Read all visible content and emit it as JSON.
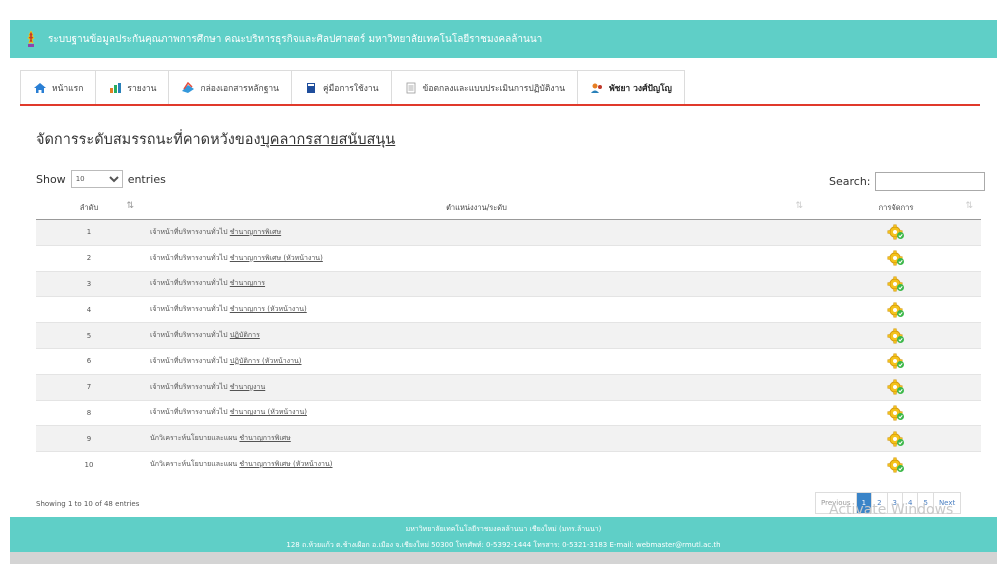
{
  "header": {
    "title": "ระบบฐานข้อมูลประกันคุณภาพการศึกษา คณะบริหารธุรกิจและศิลปศาสตร์ มหาวิทยาลัยเทคโนโลยีราชมงคลล้านนา",
    "bg_color": "#5fcfc7"
  },
  "nav": {
    "items": [
      {
        "label": "หน้าแรก",
        "icon": "home-icon"
      },
      {
        "label": "รายงาน",
        "icon": "report-icon"
      },
      {
        "label": "กล่องเอกสารหลักฐาน",
        "icon": "documents-icon"
      },
      {
        "label": "คู่มือการใช้งาน",
        "icon": "manual-icon"
      },
      {
        "label": "ข้อตกลงและแบบประเมินการปฏิบัติงาน",
        "icon": "form-icon"
      },
      {
        "label": "พัชยา วงศ์ปัญโญ",
        "icon": "user-icon"
      }
    ],
    "accent": "#e0392b"
  },
  "heading": {
    "prefix": "จัดการระดับสมรรถนะที่คาดหวังของ",
    "link": "บุคลากรสายสนับสนุน"
  },
  "table_controls": {
    "show_label": "Show",
    "length_value": "10",
    "entries_label": "entries",
    "search_label": "Search:"
  },
  "table": {
    "columns": [
      "ลำดับ",
      "ตำแหน่งงาน/ระดับ",
      "การจัดการ"
    ],
    "rows": [
      {
        "no": "1",
        "position": "เจ้าหน้าที่บริหารงานทั่วไป",
        "level": "ชำนาญการพิเศษ"
      },
      {
        "no": "2",
        "position": "เจ้าหน้าที่บริหารงานทั่วไป",
        "level": "ชำนาญการพิเศษ (หัวหน้างาน)"
      },
      {
        "no": "3",
        "position": "เจ้าหน้าที่บริหารงานทั่วไป",
        "level": "ชำนาญการ"
      },
      {
        "no": "4",
        "position": "เจ้าหน้าที่บริหารงานทั่วไป",
        "level": "ชำนาญการ (หัวหน้างาน)"
      },
      {
        "no": "5",
        "position": "เจ้าหน้าที่บริหารงานทั่วไป",
        "level": "ปฏิบัติการ"
      },
      {
        "no": "6",
        "position": "เจ้าหน้าที่บริหารงานทั่วไป",
        "level": "ปฏิบัติการ (หัวหน้างาน)"
      },
      {
        "no": "7",
        "position": "เจ้าหน้าที่บริหารงานทั่วไป",
        "level": "ชำนาญงาน"
      },
      {
        "no": "8",
        "position": "เจ้าหน้าที่บริหารงานทั่วไป",
        "level": "ชำนาญงาน (หัวหน้างาน)"
      },
      {
        "no": "9",
        "position": "นักวิเคราะห์นโยบายและแผน",
        "level": "ชำนาญการพิเศษ"
      },
      {
        "no": "10",
        "position": "นักวิเคราะห์นโยบายและแผน",
        "level": "ชำนาญการพิเศษ (หัวหน้างาน)"
      }
    ],
    "action_icon": "gear-edit-icon"
  },
  "info": "Showing 1 to 10 of 48 entries",
  "pagination": {
    "previous": "Previous",
    "pages": [
      "1",
      "2",
      "3",
      "4",
      "5"
    ],
    "active": "1",
    "next": "Next",
    "active_color": "#3a84c8"
  },
  "watermark": "Activate Windows",
  "footer": {
    "line1": "มหาวิทยาลัยเทคโนโลยีราชมงคลล้านนา เชียงใหม่ (มทร.ล้านนา)",
    "line2": "128 ถ.ห้วยแก้ว ต.ช้างเผือก อ.เมือง จ.เชียงใหม่ 50300 โทรศัพท์: 0-5392-1444 โทรสาร: 0-5321-3183 E-mail: webmaster@rmutl.ac.th"
  }
}
